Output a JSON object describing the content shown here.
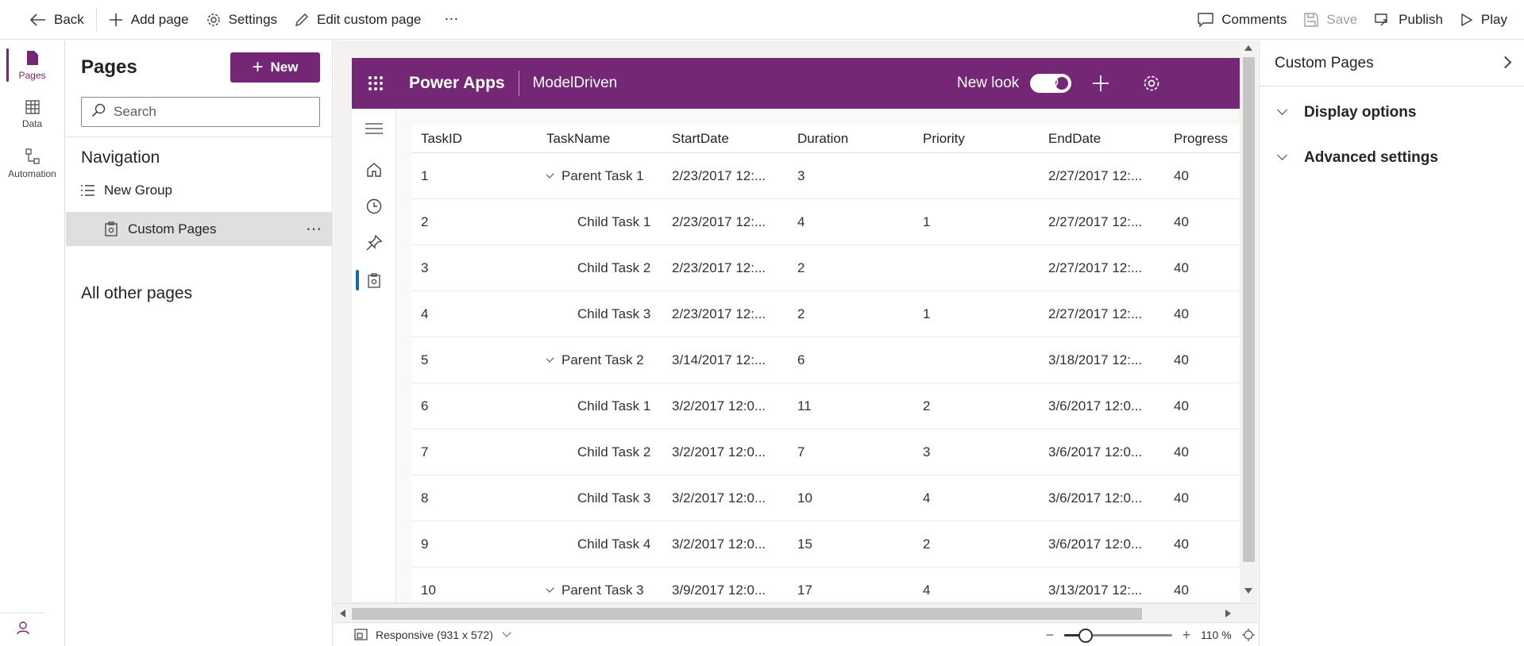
{
  "colors": {
    "brand": "#742774",
    "accent_blue": "#0f6cbd"
  },
  "commandbar": {
    "back": "Back",
    "add_page": "Add page",
    "settings": "Settings",
    "edit_custom_page": "Edit custom page",
    "more": "⋯",
    "comments": "Comments",
    "save": "Save",
    "publish": "Publish",
    "play": "Play"
  },
  "rail": {
    "items": [
      {
        "label": "Pages",
        "icon": "page-icon",
        "active": true
      },
      {
        "label": "Data",
        "icon": "table-icon",
        "active": false
      },
      {
        "label": "Automation",
        "icon": "flow-icon",
        "active": false
      }
    ],
    "bottom_icon": "copilot-icon"
  },
  "pages_pane": {
    "title": "Pages",
    "new_label": "New",
    "search_placeholder": "Search",
    "navigation_title": "Navigation",
    "group_label": "New Group",
    "selected_item": "Custom Pages",
    "more": "⋯",
    "all_other_title": "All other pages"
  },
  "app": {
    "name": "Power Apps",
    "module": "ModelDriven",
    "new_look_label": "New look",
    "new_look_on": true,
    "header_icons": [
      "search-icon",
      "plus-icon",
      "gear-icon"
    ]
  },
  "grid": {
    "columns": [
      "TaskID",
      "TaskName",
      "StartDate",
      "Duration",
      "Priority",
      "EndDate",
      "Progress"
    ],
    "rows": [
      {
        "id": "1",
        "name": "Parent Task 1",
        "parent": true,
        "start": "2/23/2017 12:...",
        "duration": "3",
        "priority": "",
        "end": "2/27/2017 12:...",
        "progress": "40"
      },
      {
        "id": "2",
        "name": "Child Task 1",
        "parent": false,
        "start": "2/23/2017 12:...",
        "duration": "4",
        "priority": "1",
        "end": "2/27/2017 12:...",
        "progress": "40"
      },
      {
        "id": "3",
        "name": "Child Task 2",
        "parent": false,
        "start": "2/23/2017 12:...",
        "duration": "2",
        "priority": "",
        "end": "2/27/2017 12:...",
        "progress": "40"
      },
      {
        "id": "4",
        "name": "Child Task 3",
        "parent": false,
        "start": "2/23/2017 12:...",
        "duration": "2",
        "priority": "1",
        "end": "2/27/2017 12:...",
        "progress": "40"
      },
      {
        "id": "5",
        "name": "Parent Task 2",
        "parent": true,
        "start": "3/14/2017 12:...",
        "duration": "6",
        "priority": "",
        "end": "3/18/2017 12:...",
        "progress": "40"
      },
      {
        "id": "6",
        "name": "Child Task 1",
        "parent": false,
        "start": "3/2/2017 12:0...",
        "duration": "11",
        "priority": "2",
        "end": "3/6/2017 12:0...",
        "progress": "40"
      },
      {
        "id": "7",
        "name": "Child Task 2",
        "parent": false,
        "start": "3/2/2017 12:0...",
        "duration": "7",
        "priority": "3",
        "end": "3/6/2017 12:0...",
        "progress": "40"
      },
      {
        "id": "8",
        "name": "Child Task 3",
        "parent": false,
        "start": "3/2/2017 12:0...",
        "duration": "10",
        "priority": "4",
        "end": "3/6/2017 12:0...",
        "progress": "40"
      },
      {
        "id": "9",
        "name": "Child Task 4",
        "parent": false,
        "start": "3/2/2017 12:0...",
        "duration": "15",
        "priority": "2",
        "end": "3/6/2017 12:0...",
        "progress": "40"
      },
      {
        "id": "10",
        "name": "Parent Task 3",
        "parent": true,
        "start": "3/9/2017 12:0...",
        "duration": "17",
        "priority": "4",
        "end": "3/13/2017 12:...",
        "progress": "40"
      }
    ]
  },
  "statusbar": {
    "layout_label": "Responsive (931 x 572)",
    "zoom_pct": "110 %",
    "zoom_level": 0.2
  },
  "props": {
    "title": "Custom Pages",
    "sections": [
      "Display options",
      "Advanced settings"
    ]
  }
}
